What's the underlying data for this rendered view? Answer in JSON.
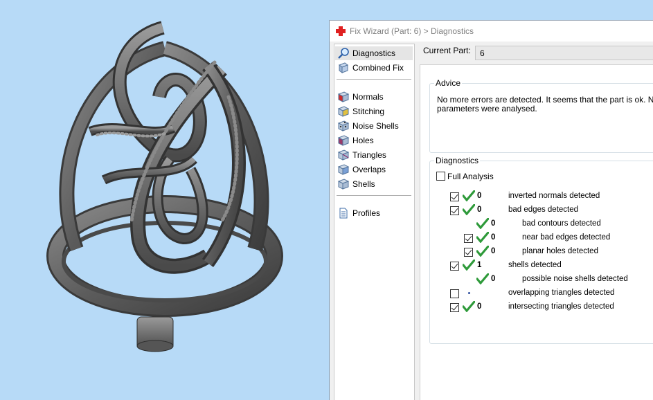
{
  "window": {
    "title": "Fix Wizard (Part: 6) > Diagnostics"
  },
  "sidebar": {
    "items": [
      {
        "label": "Diagnostics",
        "icon": "magnifier-icon",
        "selected": true
      },
      {
        "label": "Combined Fix",
        "icon": "combined-fix-icon"
      },
      {
        "label": "Normals",
        "icon": "normals-cube-icon"
      },
      {
        "label": "Stitching",
        "icon": "stitching-cube-icon"
      },
      {
        "label": "Noise Shells",
        "icon": "noise-shells-cube-icon"
      },
      {
        "label": "Holes",
        "icon": "holes-cube-icon"
      },
      {
        "label": "Triangles",
        "icon": "triangles-cube-icon"
      },
      {
        "label": "Overlaps",
        "icon": "overlaps-cube-icon"
      },
      {
        "label": "Shells",
        "icon": "shells-cube-icon"
      },
      {
        "label": "Profiles",
        "icon": "profiles-document-icon"
      }
    ]
  },
  "current_part": {
    "label": "Current Part:",
    "value": "6"
  },
  "advice": {
    "title": "Advice",
    "text": "No more errors are detected. It seems that the part is ok. Not\nparameters were analysed."
  },
  "diagnostics": {
    "title": "Diagnostics",
    "full_analysis_label": "Full Analysis",
    "full_analysis_checked": false,
    "rows": [
      {
        "checked": true,
        "status": "ok",
        "count": "0",
        "label": "inverted normals detected",
        "indent": 0
      },
      {
        "checked": true,
        "status": "ok",
        "count": "0",
        "label": "bad edges detected",
        "indent": 0
      },
      {
        "checked": null,
        "status": "ok",
        "count": "0",
        "label": "bad contours detected",
        "indent": 1
      },
      {
        "checked": true,
        "status": "ok",
        "count": "0",
        "label": "near bad edges detected",
        "indent": 1
      },
      {
        "checked": true,
        "status": "ok",
        "count": "0",
        "label": "planar holes detected",
        "indent": 1
      },
      {
        "checked": true,
        "status": "ok",
        "count": "1",
        "label": "shells detected",
        "indent": 0
      },
      {
        "checked": null,
        "status": "ok",
        "count": "0",
        "label": "possible noise shells detected",
        "indent": 1
      },
      {
        "checked": false,
        "status": "pending",
        "count": "",
        "label": "overlapping triangles detected",
        "indent": 0
      },
      {
        "checked": true,
        "status": "ok",
        "count": "0",
        "label": "intersecting triangles detected",
        "indent": 0
      }
    ]
  },
  "colors": {
    "viewport_background": "#b7daf7",
    "model_gray": "#6e6e6e",
    "ok_check": "#2e9a3a",
    "app_icon_red": "#e02020"
  }
}
